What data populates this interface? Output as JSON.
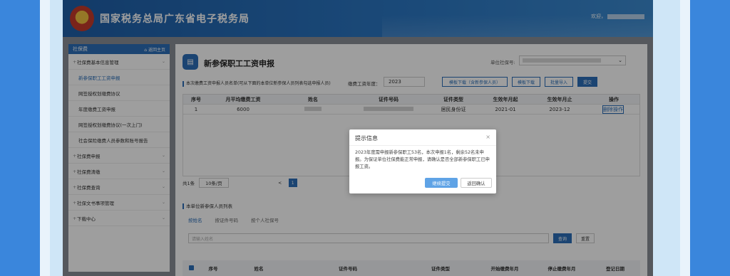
{
  "header": {
    "site_title": "国家税务总局广东省电子税务局",
    "welcome": "欢迎，"
  },
  "sidebar": {
    "head": "社保费",
    "back": "返回主页",
    "items": [
      {
        "label": "社保费基本信息管理",
        "type": "group"
      },
      {
        "label": "新参保职工工资申报",
        "type": "sub",
        "active": true
      },
      {
        "label": "网签授权划缴费协议",
        "type": "sub"
      },
      {
        "label": "年度缴费工资申报",
        "type": "sub"
      },
      {
        "label": "网签授权划缴费协议(一次上门)",
        "type": "sub"
      },
      {
        "label": "社会保险缴费人员参数和账号报告",
        "type": "sub"
      },
      {
        "label": "社保费申报",
        "type": "group"
      },
      {
        "label": "社保费清缴",
        "type": "group"
      },
      {
        "label": "社保费查询",
        "type": "group"
      },
      {
        "label": "社保文书事项管理",
        "type": "group"
      },
      {
        "label": "下载中心",
        "type": "group"
      }
    ]
  },
  "main": {
    "title": "新参保职工工资申报",
    "unit_label": "单位社保号:",
    "hint": "本次缴费工资申报人员名单(可从下面的本单位新参保人员列表勾选申报人员)",
    "year_label": "缴费工资年度：",
    "year_value": "2023",
    "buttons": {
      "template_download": "模板下载（含新参保人员）",
      "template_download2": "模板下载",
      "batch_import": "批量导入",
      "submit": "提交"
    },
    "table1": {
      "headers": [
        "序号",
        "月平均缴费工资",
        "姓名",
        "证件号码",
        "证件类型",
        "生效年月起",
        "生效年月止",
        "操作"
      ],
      "rows": [
        [
          "1",
          "6000",
          "",
          "",
          "居民身份证",
          "2021-01",
          "2023-12",
          "删除操作"
        ]
      ]
    },
    "pager": {
      "total": "共1条",
      "size": "10条/页",
      "prev": "<",
      "current": "1"
    },
    "section2": {
      "title": "本单位新参保人员列表",
      "tabs": [
        "按姓名",
        "按证件号码",
        "按个人社保号"
      ],
      "search_placeholder": "请输入姓名",
      "query": "查询",
      "reset": "重置",
      "headers": [
        "序号",
        "姓名",
        "证件号码",
        "证件类型",
        "开始缴费年月",
        "停止缴费年月",
        "登记日期"
      ]
    }
  },
  "modal": {
    "title": "提示信息",
    "close": "×",
    "body": "2023年度需申报新参保职工53名，本次申报1名，剩余52名未申报。为保证单位社保费能正常申报，请确认是否全部新参保职工已申报工资。",
    "primary": "继续提交",
    "secondary": "返回确认"
  },
  "colors": {
    "brand": "#2c6fb8",
    "frame": "#3a86dc",
    "modal_primary": "#5fa3e6"
  }
}
